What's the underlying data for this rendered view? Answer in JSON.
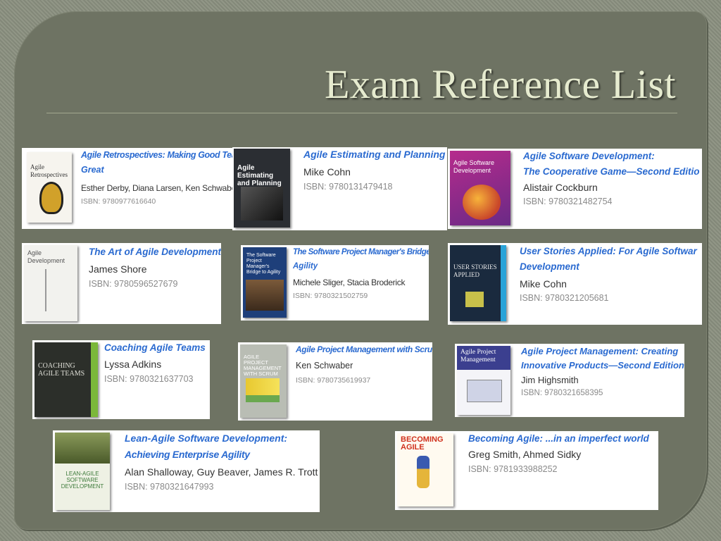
{
  "slide": {
    "title": "Exam Reference List"
  },
  "books": [
    {
      "title1": "Agile Retrospectives: Making Good Teams",
      "title2": "Great",
      "authors": "Esther Derby, Diana Larsen, Ken Schwaber",
      "isbn": "ISBN: 9780977616640",
      "cover_text": "Agile Retrospectives"
    },
    {
      "title1": "Agile Estimating and Planning",
      "title2": "",
      "authors": "Mike Cohn",
      "isbn": "ISBN: 9780131479418",
      "cover_text": "Agile Estimating and Planning"
    },
    {
      "title1": "Agile Software Development:",
      "title2": "The Cooperative Game—Second Editio",
      "authors": "Alistair Cockburn",
      "isbn": "ISBN: 9780321482754",
      "cover_text": "Agile Software Development"
    },
    {
      "title1": "The Art of Agile Development",
      "title2": "",
      "authors": "James Shore",
      "isbn": "ISBN: 9780596527679",
      "cover_text": "Agile Development"
    },
    {
      "title1": "The Software Project Manager's Bridge to",
      "title2": "Agility",
      "authors": "Michele Sliger, Stacia Broderick",
      "isbn": "ISBN: 9780321502759",
      "cover_text": "The Software Project Manager's Bridge to Agility"
    },
    {
      "title1": "User Stories Applied: For Agile Softwar",
      "title2": "Development",
      "authors": "Mike Cohn",
      "isbn": "ISBN: 9780321205681",
      "cover_text": "USER STORIES APPLIED"
    },
    {
      "title1": "Coaching Agile Teams",
      "title2": "",
      "authors": "Lyssa Adkins",
      "isbn": "ISBN: 9780321637703",
      "cover_text": "COACHING AGILE TEAMS"
    },
    {
      "title1": "Agile Project Management with Scrum",
      "title2": "",
      "authors": "Ken Schwaber",
      "isbn": "ISBN: 9780735619937",
      "cover_text": "AGILE PROJECT MANAGEMENT WITH SCRUM"
    },
    {
      "title1": "Agile Project Management: Creating",
      "title2": "Innovative Products—Second Edition",
      "authors": "Jim Highsmith",
      "isbn": "ISBN: 9780321658395",
      "cover_text": "Agile Project Management"
    },
    {
      "title1": "Lean-Agile Software Development:",
      "title2": "Achieving Enterprise Agility",
      "authors": "Alan Shalloway, Guy Beaver, James R. Trott",
      "isbn": "ISBN: 9780321647993",
      "cover_text": "LEAN-AGILE SOFTWARE DEVELOPMENT"
    },
    {
      "title1": "Becoming Agile: ...in an imperfect world",
      "title2": "",
      "authors": "Greg Smith, Ahmed Sidky",
      "isbn": "ISBN: 9781933988252",
      "cover_text": "BECOMING AGILE"
    }
  ],
  "colors": {
    "background": "#6e7363",
    "title": "#e6ebcf",
    "book_title": "#2a6ad0"
  }
}
